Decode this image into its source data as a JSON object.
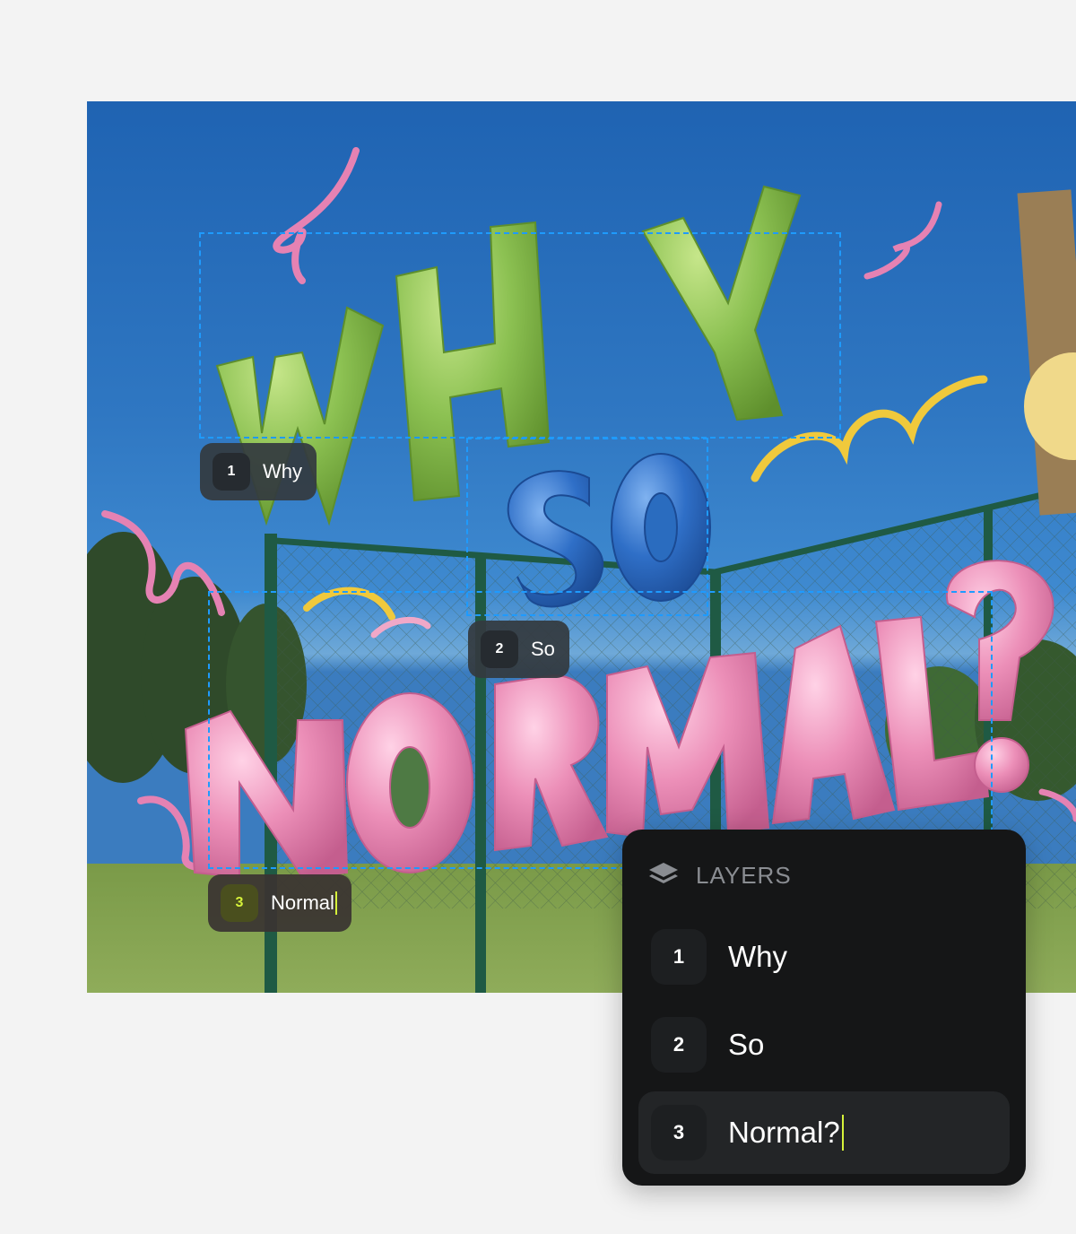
{
  "layers_panel": {
    "title": "LAYERS",
    "icon": "stack-icon",
    "items": [
      {
        "number": "1",
        "label": "Why"
      },
      {
        "number": "2",
        "label": "So"
      },
      {
        "number": "3",
        "label": "Normal?",
        "active": true
      }
    ]
  },
  "canvas_tags": [
    {
      "number": "1",
      "label": "Why"
    },
    {
      "number": "2",
      "label": "So"
    },
    {
      "number": "3",
      "label": "Normal",
      "editing": true
    }
  ],
  "artwork": {
    "word_1": "WHY",
    "word_2": "SO",
    "word_3": "NORMAL?"
  },
  "colors": {
    "selection": "#1e9bff",
    "accent": "#d6f23a",
    "green_letters": "#8cc152",
    "blue_letters": "#2f6fc7",
    "pink_letters": "#ec8fb8",
    "panel_bg": "#151617"
  }
}
